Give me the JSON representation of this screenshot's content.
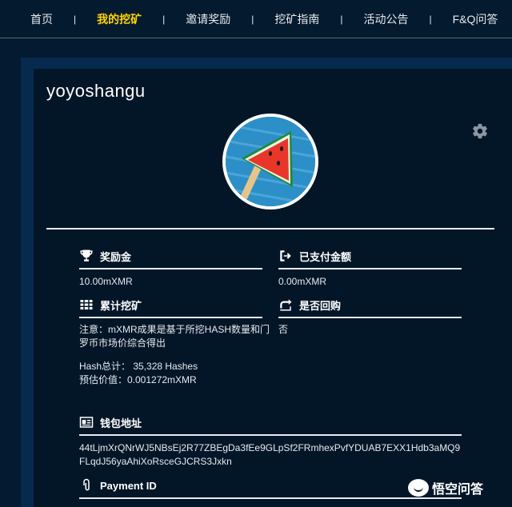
{
  "nav": {
    "items": [
      {
        "label": "首页"
      },
      {
        "label": "我的挖矿"
      },
      {
        "label": "邀请奖励"
      },
      {
        "label": "挖矿指南"
      },
      {
        "label": "活动公告"
      },
      {
        "label": "F&Q问答"
      }
    ],
    "separator": "|",
    "active_index": 1,
    "active_color": "#ffd400"
  },
  "profile": {
    "username": "yoyoshangu",
    "avatar_icon": "watermelon-popsicle-avatar",
    "settings_icon": "gear-icon"
  },
  "sections": {
    "reward": {
      "title": "奖励金",
      "icon": "trophy-icon",
      "value": "10.00mXMR"
    },
    "paid": {
      "title": "已支付金额",
      "icon": "sign-out-icon",
      "value": "0.00mXMR"
    },
    "accumulated": {
      "title": "累计挖矿",
      "icon": "grid-icon",
      "note": "注意：mXMR成果是基于所挖HASH数量和门罗币市场价综合得出",
      "hash_total": "Hash总计： 35,328 Hashes",
      "estimated_value": "预估价值：0.001272mXMR"
    },
    "buyback": {
      "title": "是否回购",
      "icon": "share-icon",
      "value": "否"
    },
    "wallet": {
      "title": "钱包地址",
      "icon": "id-card-icon",
      "address": "44tLjmXrQNrWJ5NBsEj2R77ZBEgDa3fEe9GLpSf2FRmhexPvfYDUAB7EXX1Hdb3aMQ9FLqdJ56yaAhiXoRsceGJCRS3Jxkn"
    },
    "payment_id": {
      "title": "Payment ID",
      "icon": "paperclip-icon"
    }
  },
  "watermark": {
    "text": "悟空问答"
  },
  "colors": {
    "background": "#031a30",
    "panel": "#062a4e",
    "card": "#031628",
    "text": "#e6ebf0"
  }
}
